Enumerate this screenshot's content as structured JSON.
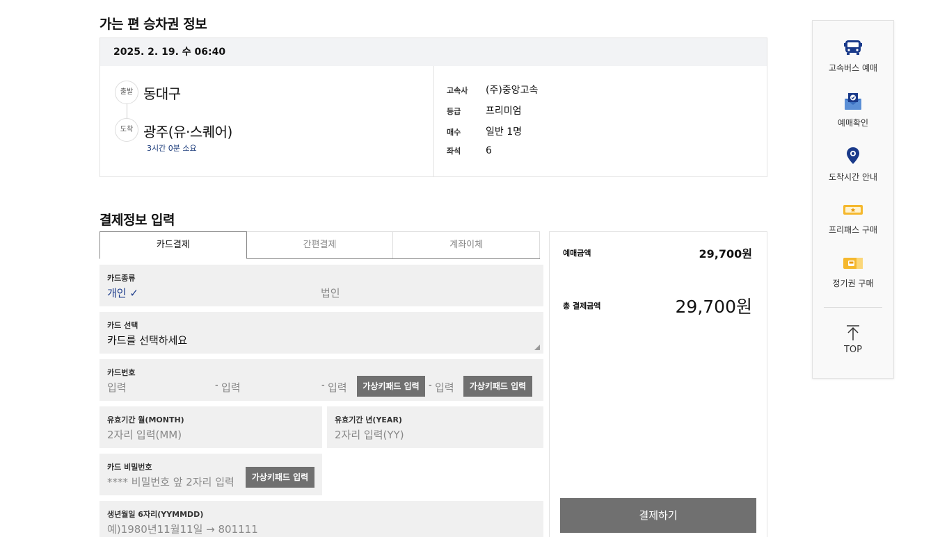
{
  "outbound": {
    "title": "가는 편 승차권 정보",
    "datetime": "2025. 2. 19. 수 06:40",
    "depart_badge": "출발",
    "depart": "동대구",
    "arrive_badge": "도착",
    "arrive": "광주(유·스퀘어)",
    "duration": "3시간 0분 소요",
    "details": [
      {
        "key": "고속사",
        "value": "(주)중앙고속"
      },
      {
        "key": "등급",
        "value": "프리미엄"
      },
      {
        "key": "매수",
        "value": "일반 1명"
      },
      {
        "key": "좌석",
        "value": "6"
      }
    ]
  },
  "payment": {
    "title": "결제정보 입력",
    "tabs": [
      "카드결제",
      "간편결제",
      "계좌이체"
    ],
    "card_type": {
      "label": "카드종류",
      "personal": "개인 ✓",
      "corporate": "법인"
    },
    "card_select": {
      "label": "카드 선택",
      "value": "카드를 선택하세요"
    },
    "card_number": {
      "label": "카드번호",
      "p1": "입력",
      "p2": "입력",
      "p3": "입력",
      "p4": "입력",
      "dash": "-",
      "vk1": "가상키패드 입력",
      "vk2": "가상키패드 입력"
    },
    "exp_month": {
      "label": "유효기간 월(MONTH)",
      "placeholder": "2자리 입력(MM)"
    },
    "exp_year": {
      "label": "유효기간 년(YEAR)",
      "placeholder": "2자리 입력(YY)"
    },
    "card_pw": {
      "label": "카드 비밀번호",
      "placeholder": "**** 비밀번호 앞 2자리 입력",
      "vk": "가상키패드 입력"
    },
    "birth": {
      "label": "생년월일 6자리(YYMMDD)",
      "placeholder": "예)1980년11월11일 → 801111"
    }
  },
  "summary": {
    "fare_label": "예매금액",
    "fare_value": "29,700원",
    "total_label": "총 결제금액",
    "total_value": "29,700원",
    "pay_button": "결제하기"
  },
  "quick_menu": {
    "items": [
      {
        "label": "고속버스 예매",
        "icon": "bus-icon"
      },
      {
        "label": "예매확인",
        "icon": "mail-check-icon"
      },
      {
        "label": "도착시간 안내",
        "icon": "location-pin-icon"
      },
      {
        "label": "프리패스 구매",
        "icon": "ticket-star-icon"
      },
      {
        "label": "정기권 구매",
        "icon": "ticket-bus-icon"
      }
    ],
    "top_label": "TOP"
  },
  "colors": {
    "navy": "#1a3a8a",
    "gold": "#f5b82e",
    "button_gray": "#707070"
  }
}
